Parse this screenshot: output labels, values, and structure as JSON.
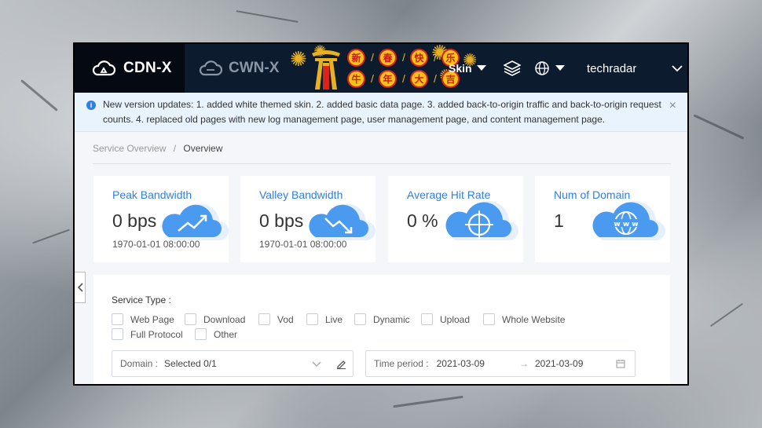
{
  "header": {
    "brand_primary": "CDN-X",
    "brand_secondary": "CWN-X",
    "festive_chars": [
      "新",
      "春",
      "快",
      "乐",
      "牛",
      "年",
      "大",
      "吉"
    ],
    "skin_label": "Skin",
    "username": "techradar"
  },
  "notice": {
    "text": "New version updates: 1. added white themed skin. 2. added basic data page. 3. added back-to-origin traffic and back-to-origin request counts. 4. replaced old pages with new log management page, user management page, and content management page.",
    "close_glyph": "×"
  },
  "breadcrumb": {
    "parent": "Service Overview",
    "separator": "/",
    "current": "Overview"
  },
  "cards": [
    {
      "label": "Peak Bandwidth",
      "value": "0 bps",
      "date": "1970-01-01 08:00:00",
      "icon": "chart-up-cloud-icon"
    },
    {
      "label": "Valley Bandwidth",
      "value": "0 bps",
      "date": "1970-01-01 08:00:00",
      "icon": "chart-down-cloud-icon"
    },
    {
      "label": "Average Hit Rate",
      "value": "0 %",
      "icon": "target-cloud-icon"
    },
    {
      "label": "Num of Domain",
      "value": "1",
      "icon": "www-cloud-icon"
    }
  ],
  "filters": {
    "service_type_label": "Service Type :",
    "service_types": [
      "Web Page",
      "Download",
      "Vod",
      "Live",
      "Dynamic",
      "Upload",
      "Whole Website",
      "Full Protocol",
      "Other"
    ],
    "domain_label": "Domain :",
    "domain_value": "Selected 0/1",
    "time_label": "Time period :",
    "time_start": "2021-03-09",
    "time_arrow": "→",
    "time_end": "2021-03-09"
  },
  "colors": {
    "topbar": "#0d1b2e",
    "accent": "#2f7ee0",
    "notice_bg": "#e8f3fd"
  }
}
